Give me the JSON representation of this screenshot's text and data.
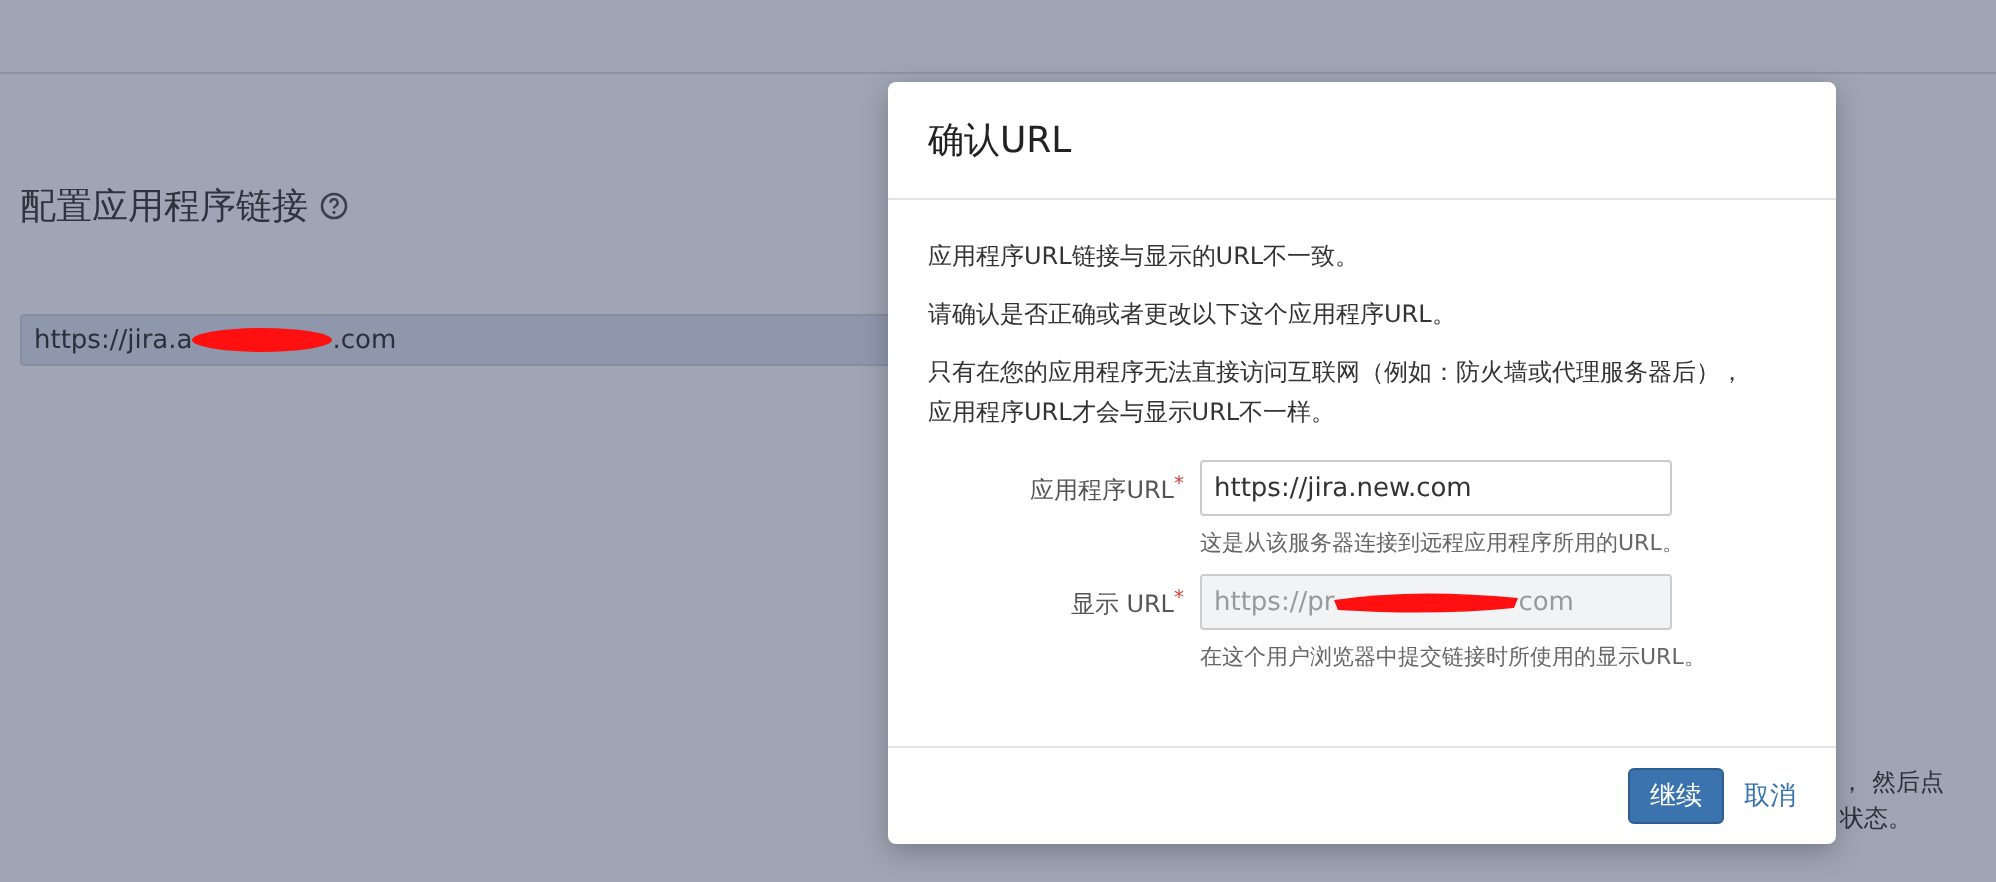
{
  "page": {
    "heading": "配置应用程序链接",
    "url_field": {
      "value_start": "https://jira.a",
      "value_end": ".com"
    },
    "behind_text": [
      "， 然后点",
      "状态。"
    ]
  },
  "dialog": {
    "title": "确认URL",
    "paragraphs": [
      "应用程序URL链接与显示的URL不一致。",
      "请确认是否正确或者更改以下这个应用程序URL。",
      "只有在您的应用程序无法直接访问互联网（例如：防火墙或代理服务器后），应用程序URL才会与显示URL不一样。"
    ],
    "fields": [
      {
        "label": "应用程序URL",
        "required_mark": "*",
        "value": "https://jira.new.com",
        "disabled": false,
        "redacted": false,
        "help": "这是从该服务器连接到远程应用程序所用的URL。"
      },
      {
        "label": "显示 URL",
        "required_mark": "*",
        "value": "https://pr",
        "value_end": "com",
        "disabled": true,
        "redacted": true,
        "help": "在这个用户浏览器中提交链接时所使用的显示URL。"
      }
    ],
    "buttons": [
      {
        "label": "继续",
        "kind": "primary"
      },
      {
        "label": "取消",
        "kind": "link"
      }
    ]
  }
}
